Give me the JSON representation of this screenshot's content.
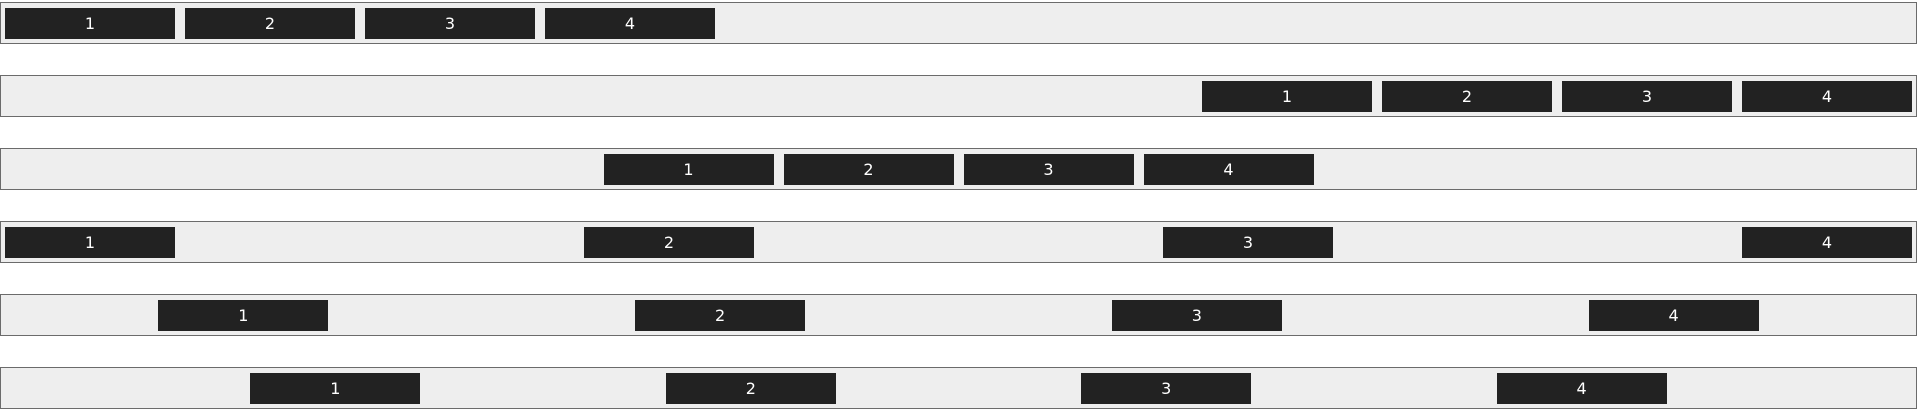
{
  "rows": [
    {
      "items": [
        "1",
        "2",
        "3",
        "4"
      ]
    },
    {
      "items": [
        "1",
        "2",
        "3",
        "4"
      ]
    },
    {
      "items": [
        "1",
        "2",
        "3",
        "4"
      ]
    },
    {
      "items": [
        "1",
        "2",
        "3",
        "4"
      ]
    },
    {
      "items": [
        "1",
        "2",
        "3",
        "4"
      ]
    },
    {
      "items": [
        "1",
        "2",
        "3",
        "4"
      ]
    }
  ],
  "colors": {
    "container_bg": "#eeeeee",
    "container_border": "#6b6b6b",
    "item_bg": "#222222",
    "item_text": "#ffffff"
  }
}
